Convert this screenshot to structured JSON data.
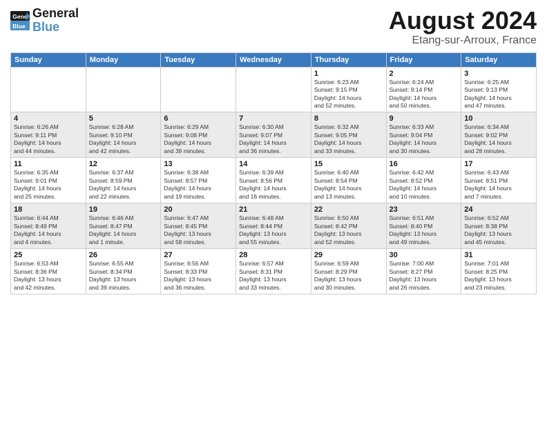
{
  "header": {
    "logo_general": "General",
    "logo_blue": "Blue",
    "title": "August 2024",
    "subtitle": "Etang-sur-Arroux, France"
  },
  "calendar": {
    "columns": [
      "Sunday",
      "Monday",
      "Tuesday",
      "Wednesday",
      "Thursday",
      "Friday",
      "Saturday"
    ],
    "weeks": [
      {
        "days": [
          {
            "num": "",
            "info": ""
          },
          {
            "num": "",
            "info": ""
          },
          {
            "num": "",
            "info": ""
          },
          {
            "num": "",
            "info": ""
          },
          {
            "num": "1",
            "info": "Sunrise: 6:23 AM\nSunset: 9:15 PM\nDaylight: 14 hours\nand 52 minutes."
          },
          {
            "num": "2",
            "info": "Sunrise: 6:24 AM\nSunset: 9:14 PM\nDaylight: 14 hours\nand 50 minutes."
          },
          {
            "num": "3",
            "info": "Sunrise: 6:25 AM\nSunset: 9:13 PM\nDaylight: 14 hours\nand 47 minutes."
          }
        ]
      },
      {
        "days": [
          {
            "num": "4",
            "info": "Sunrise: 6:26 AM\nSunset: 9:11 PM\nDaylight: 14 hours\nand 44 minutes."
          },
          {
            "num": "5",
            "info": "Sunrise: 6:28 AM\nSunset: 9:10 PM\nDaylight: 14 hours\nand 42 minutes."
          },
          {
            "num": "6",
            "info": "Sunrise: 6:29 AM\nSunset: 9:08 PM\nDaylight: 14 hours\nand 39 minutes."
          },
          {
            "num": "7",
            "info": "Sunrise: 6:30 AM\nSunset: 9:07 PM\nDaylight: 14 hours\nand 36 minutes."
          },
          {
            "num": "8",
            "info": "Sunrise: 6:32 AM\nSunset: 9:05 PM\nDaylight: 14 hours\nand 33 minutes."
          },
          {
            "num": "9",
            "info": "Sunrise: 6:33 AM\nSunset: 9:04 PM\nDaylight: 14 hours\nand 30 minutes."
          },
          {
            "num": "10",
            "info": "Sunrise: 6:34 AM\nSunset: 9:02 PM\nDaylight: 14 hours\nand 28 minutes."
          }
        ]
      },
      {
        "days": [
          {
            "num": "11",
            "info": "Sunrise: 6:35 AM\nSunset: 9:01 PM\nDaylight: 14 hours\nand 25 minutes."
          },
          {
            "num": "12",
            "info": "Sunrise: 6:37 AM\nSunset: 8:59 PM\nDaylight: 14 hours\nand 22 minutes."
          },
          {
            "num": "13",
            "info": "Sunrise: 6:38 AM\nSunset: 8:57 PM\nDaylight: 14 hours\nand 19 minutes."
          },
          {
            "num": "14",
            "info": "Sunrise: 6:39 AM\nSunset: 8:56 PM\nDaylight: 14 hours\nand 16 minutes."
          },
          {
            "num": "15",
            "info": "Sunrise: 6:40 AM\nSunset: 8:54 PM\nDaylight: 14 hours\nand 13 minutes."
          },
          {
            "num": "16",
            "info": "Sunrise: 6:42 AM\nSunset: 8:52 PM\nDaylight: 14 hours\nand 10 minutes."
          },
          {
            "num": "17",
            "info": "Sunrise: 6:43 AM\nSunset: 8:51 PM\nDaylight: 14 hours\nand 7 minutes."
          }
        ]
      },
      {
        "days": [
          {
            "num": "18",
            "info": "Sunrise: 6:44 AM\nSunset: 8:49 PM\nDaylight: 14 hours\nand 4 minutes."
          },
          {
            "num": "19",
            "info": "Sunrise: 6:46 AM\nSunset: 8:47 PM\nDaylight: 14 hours\nand 1 minute."
          },
          {
            "num": "20",
            "info": "Sunrise: 6:47 AM\nSunset: 8:45 PM\nDaylight: 13 hours\nand 58 minutes."
          },
          {
            "num": "21",
            "info": "Sunrise: 6:48 AM\nSunset: 8:44 PM\nDaylight: 13 hours\nand 55 minutes."
          },
          {
            "num": "22",
            "info": "Sunrise: 6:50 AM\nSunset: 8:42 PM\nDaylight: 13 hours\nand 52 minutes."
          },
          {
            "num": "23",
            "info": "Sunrise: 6:51 AM\nSunset: 8:40 PM\nDaylight: 13 hours\nand 49 minutes."
          },
          {
            "num": "24",
            "info": "Sunrise: 6:52 AM\nSunset: 8:38 PM\nDaylight: 13 hours\nand 45 minutes."
          }
        ]
      },
      {
        "days": [
          {
            "num": "25",
            "info": "Sunrise: 6:53 AM\nSunset: 8:36 PM\nDaylight: 13 hours\nand 42 minutes."
          },
          {
            "num": "26",
            "info": "Sunrise: 6:55 AM\nSunset: 8:34 PM\nDaylight: 13 hours\nand 39 minutes."
          },
          {
            "num": "27",
            "info": "Sunrise: 6:56 AM\nSunset: 8:33 PM\nDaylight: 13 hours\nand 36 minutes."
          },
          {
            "num": "28",
            "info": "Sunrise: 6:57 AM\nSunset: 8:31 PM\nDaylight: 13 hours\nand 33 minutes."
          },
          {
            "num": "29",
            "info": "Sunrise: 6:59 AM\nSunset: 8:29 PM\nDaylight: 13 hours\nand 30 minutes."
          },
          {
            "num": "30",
            "info": "Sunrise: 7:00 AM\nSunset: 8:27 PM\nDaylight: 13 hours\nand 26 minutes."
          },
          {
            "num": "31",
            "info": "Sunrise: 7:01 AM\nSunset: 8:25 PM\nDaylight: 13 hours\nand 23 minutes."
          }
        ]
      }
    ]
  }
}
